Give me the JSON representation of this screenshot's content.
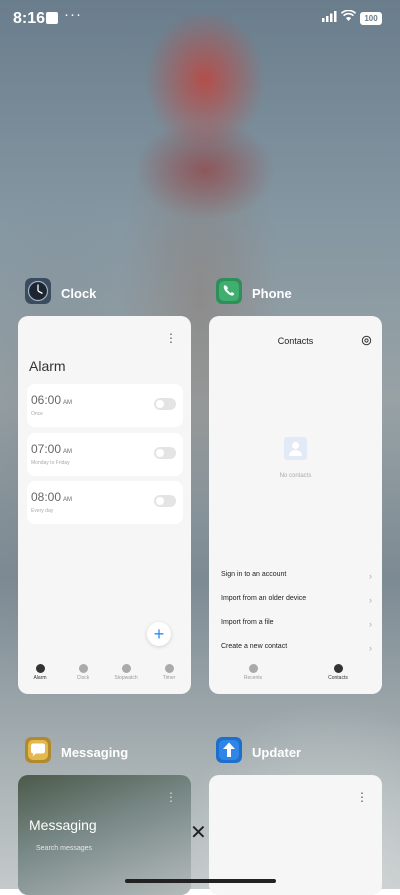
{
  "status": {
    "time": "8:16",
    "more": "···",
    "battery": "100"
  },
  "clock_card": {
    "app_name": "Clock",
    "title": "Alarm",
    "alarms": [
      {
        "time": "06:00",
        "ampm": "AM",
        "repeat": "Once"
      },
      {
        "time": "07:00",
        "ampm": "AM",
        "repeat": "Monday to Friday"
      },
      {
        "time": "08:00",
        "ampm": "AM",
        "repeat": "Every day"
      }
    ],
    "add": "+",
    "nav": [
      "Alarm",
      "Clock",
      "Stopwatch",
      "Timer"
    ]
  },
  "phone_card": {
    "app_name": "Phone",
    "title": "Contacts",
    "empty": "No contacts",
    "options": [
      "Sign in to an account",
      "Import from an older device",
      "Import from a file",
      "Create a new contact"
    ],
    "nav": [
      "Recents",
      "Contacts"
    ]
  },
  "messaging_card": {
    "app_name": "Messaging",
    "title": "Messaging",
    "search": "Search messages"
  },
  "updater_card": {
    "app_name": "Updater"
  },
  "close": "✕"
}
